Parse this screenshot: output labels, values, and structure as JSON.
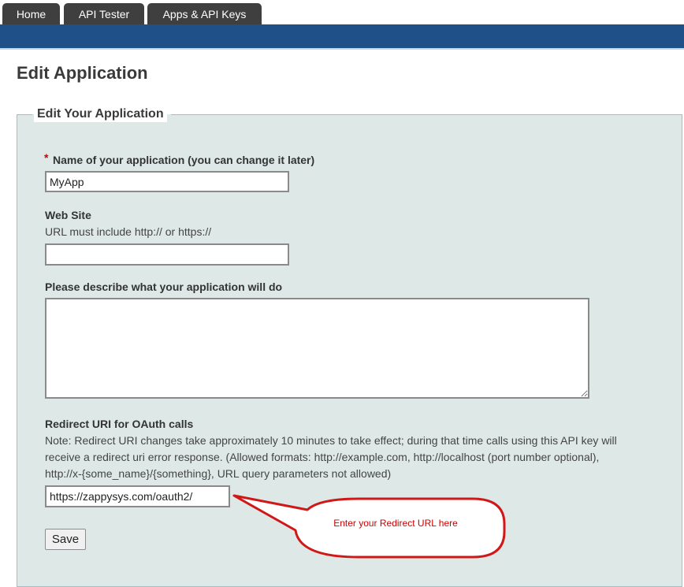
{
  "nav": {
    "tabs": [
      {
        "label": "Home"
      },
      {
        "label": "API Tester"
      },
      {
        "label": "Apps & API Keys"
      }
    ]
  },
  "page": {
    "title": "Edit Application"
  },
  "form": {
    "legend": "Edit Your Application",
    "required_marker": "*",
    "name": {
      "label": "Name of your application (you can change it later)",
      "value": "MyApp"
    },
    "website": {
      "label": "Web Site",
      "help": "URL must include http:// or https://",
      "value": ""
    },
    "description": {
      "label": "Please describe what your application will do",
      "value": ""
    },
    "redirect": {
      "label": "Redirect URI for OAuth calls",
      "note": "Note:  Redirect URI changes take approximately 10 minutes to take effect; during that time calls using this API key will receive a redirect uri error response.     (Allowed formats: http://example.com, http://localhost (port number optional), http://x-{some_name}/{something}, URL query parameters not allowed)",
      "value": "https://zappysys.com/oauth2/"
    },
    "save_label": "Save"
  },
  "callout": {
    "text": "Enter your Redirect URL here",
    "color": "#cc0000"
  },
  "colors": {
    "nav_bar": "#1f5087",
    "tab": "#3f3f3f",
    "panel": "#dee9e7"
  }
}
